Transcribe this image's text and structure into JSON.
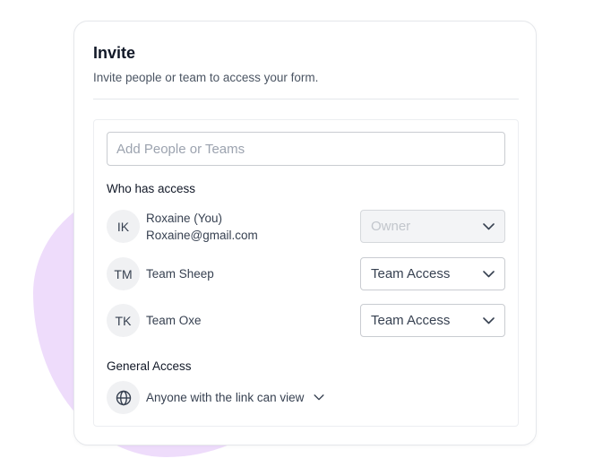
{
  "invite": {
    "title": "Invite",
    "subtitle": "Invite people or team to access your form.",
    "search_placeholder": "Add People or Teams",
    "who_has_access_label": "Who has access",
    "members": [
      {
        "initials": "IK",
        "name": "Roxaine (You)",
        "email": "Roxaine@gmail.com",
        "role": "Owner",
        "role_disabled": true
      },
      {
        "initials": "TM",
        "name": "Team Sheep",
        "role": "Team Access"
      },
      {
        "initials": "TK",
        "name": "Team Oxe",
        "role": "Team Access"
      }
    ],
    "general_access_label": "General Access",
    "general_access_value": "Anyone with the link can view"
  },
  "colors": {
    "accent_blob": "#eedcfb",
    "border": "#c9ccd1",
    "text": "#374151"
  },
  "icons": [
    "chevron-down-icon",
    "globe-icon"
  ]
}
